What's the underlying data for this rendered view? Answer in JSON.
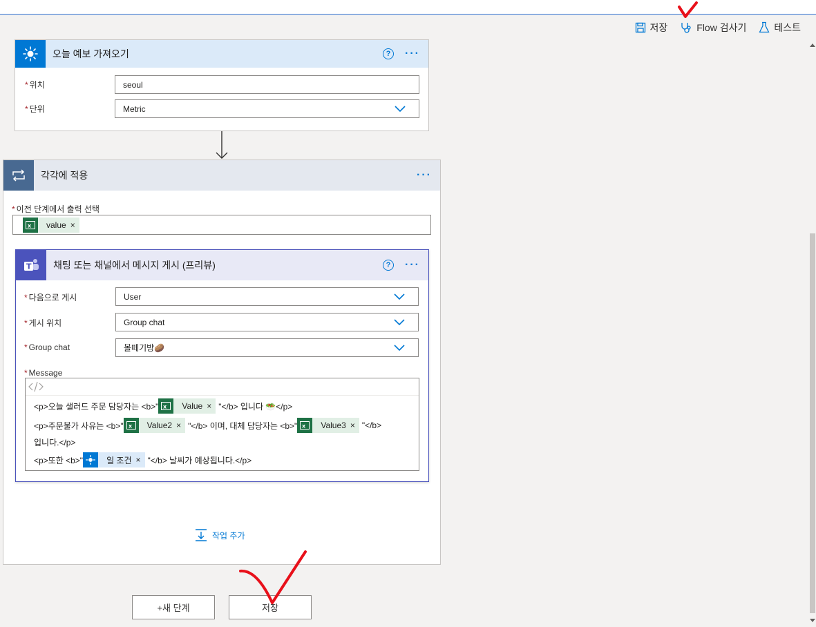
{
  "toolbar": {
    "save": "저장",
    "checker": "Flow 검사기",
    "test": "테스트"
  },
  "weather_card": {
    "title": "오늘 예보 가져오기",
    "location_label": "위치",
    "location_value": "seoul",
    "units_label": "단위",
    "units_value": "Metric"
  },
  "foreach_card": {
    "title": "각각에 적용",
    "select_label": "이전 단계에서 출력 선택",
    "select_token": "value"
  },
  "teams_card": {
    "title": "채팅 또는 채널에서 메시지 게시 (프리뷰)",
    "post_as_label": "다음으로 게시",
    "post_as_value": "User",
    "post_in_label": "게시 위치",
    "post_in_value": "Group chat",
    "group_chat_label": "Group chat",
    "group_chat_value": "볼떼기방🥔",
    "message_label": "Message",
    "message": {
      "line1_pre": "<p>오늘 샐러드 주문 담당자는 <b>\"",
      "line1_token": "Value",
      "line1_post": "\"</b> 입니다 🥗</p>",
      "line2_pre": "<p>주문불가 사유는 <b>\"",
      "line2_token": "Value2",
      "line2_mid": "\"</b> 이며, 대체 담당자는 <b>\"",
      "line2_token2": "Value3",
      "line2_post": "\"</b>",
      "line3": "입니다.</p>",
      "line4_pre": "<p>또한 <b>\"",
      "line4_token": "일 조건",
      "line4_post": "\"</b> 날씨가 예상됩니다.</p>"
    }
  },
  "add_action": "작업 추가",
  "buttons": {
    "new_step": "+새 단계",
    "save": "저장"
  },
  "colors": {
    "accent": "#0078d4",
    "excel": "#1e7145",
    "teams": "#4b53bc",
    "loop": "#486991",
    "annotation": "#e8101a"
  }
}
